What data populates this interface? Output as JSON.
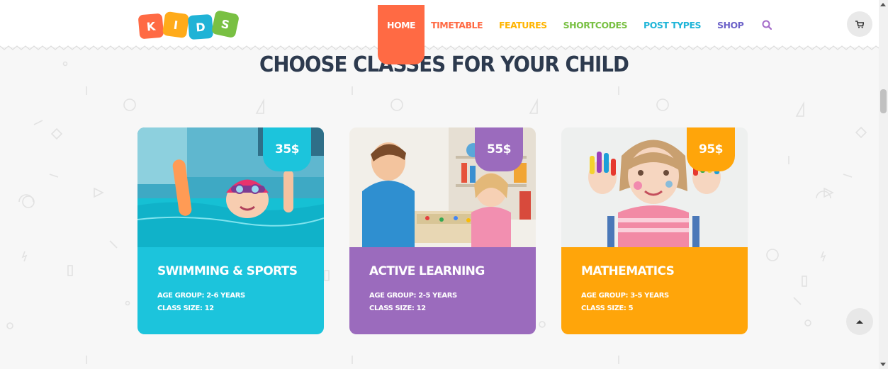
{
  "logo": {
    "letters": [
      "K",
      "I",
      "D",
      "S"
    ],
    "colors": [
      "#ff6a44",
      "#ffab1a",
      "#20b3d6",
      "#79c043"
    ]
  },
  "nav": {
    "items": [
      {
        "label": "HOME",
        "color": "#ffffff",
        "active": true
      },
      {
        "label": "TIMETABLE",
        "color": "#ff6a44"
      },
      {
        "label": "FEATURES",
        "color": "#ffb400"
      },
      {
        "label": "SHORTCODES",
        "color": "#79c043"
      },
      {
        "label": "POST TYPES",
        "color": "#1fb5d8"
      },
      {
        "label": "SHOP",
        "color": "#6d63c9"
      }
    ],
    "search_icon": "search-icon",
    "search_color": "#a46bc9"
  },
  "cart": {
    "icon": "cart-icon"
  },
  "section": {
    "title": "CHOOSE CLASSES FOR YOUR CHILD"
  },
  "classes": [
    {
      "name": "SWIMMING & SPORTS",
      "price": "35$",
      "age_group": "AGE GROUP: 2-6 YEARS",
      "class_size": "CLASS SIZE: 12",
      "color": "#1cc4dc",
      "photo": "child-swimming-photo"
    },
    {
      "name": "ACTIVE LEARNING",
      "price": "55$",
      "age_group": "AGE GROUP: 2-5 YEARS",
      "class_size": "CLASS SIZE: 12",
      "color": "#9b6bbd",
      "photo": "children-playing-board-game-photo"
    },
    {
      "name": "MATHEMATICS",
      "price": "95$",
      "age_group": "AGE GROUP: 3-5 YEARS",
      "class_size": "CLASS SIZE: 5",
      "color": "#ffa50a",
      "photo": "girl-painted-hands-photo"
    }
  ],
  "back_to_top": {
    "icon": "arrow-up-icon"
  }
}
